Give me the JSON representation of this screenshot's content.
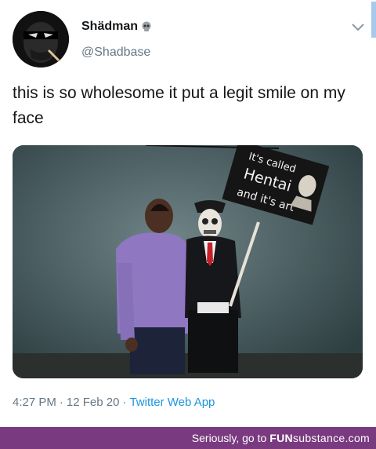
{
  "tweet": {
    "display_name": "Shädman",
    "name_emoji": "skull-icon",
    "handle": "@Shadbase",
    "text": "this is so wholesome it put a legit smile on my face",
    "time": "4:27 PM",
    "date": "12 Feb 20",
    "source": "Twitter Web App",
    "separator": "·"
  },
  "media": {
    "sign_text": {
      "line1": "It's called",
      "line2": "Hentai",
      "line3": "and it's art"
    }
  },
  "footer": {
    "text": "Seriously, go to",
    "brand_fun": "FUN",
    "brand_rest": "substance.com"
  },
  "colors": {
    "footer_bg": "#7a3a80",
    "link": "#1b95e0",
    "muted": "#657786",
    "accent_bar": "#a7c9eb"
  }
}
